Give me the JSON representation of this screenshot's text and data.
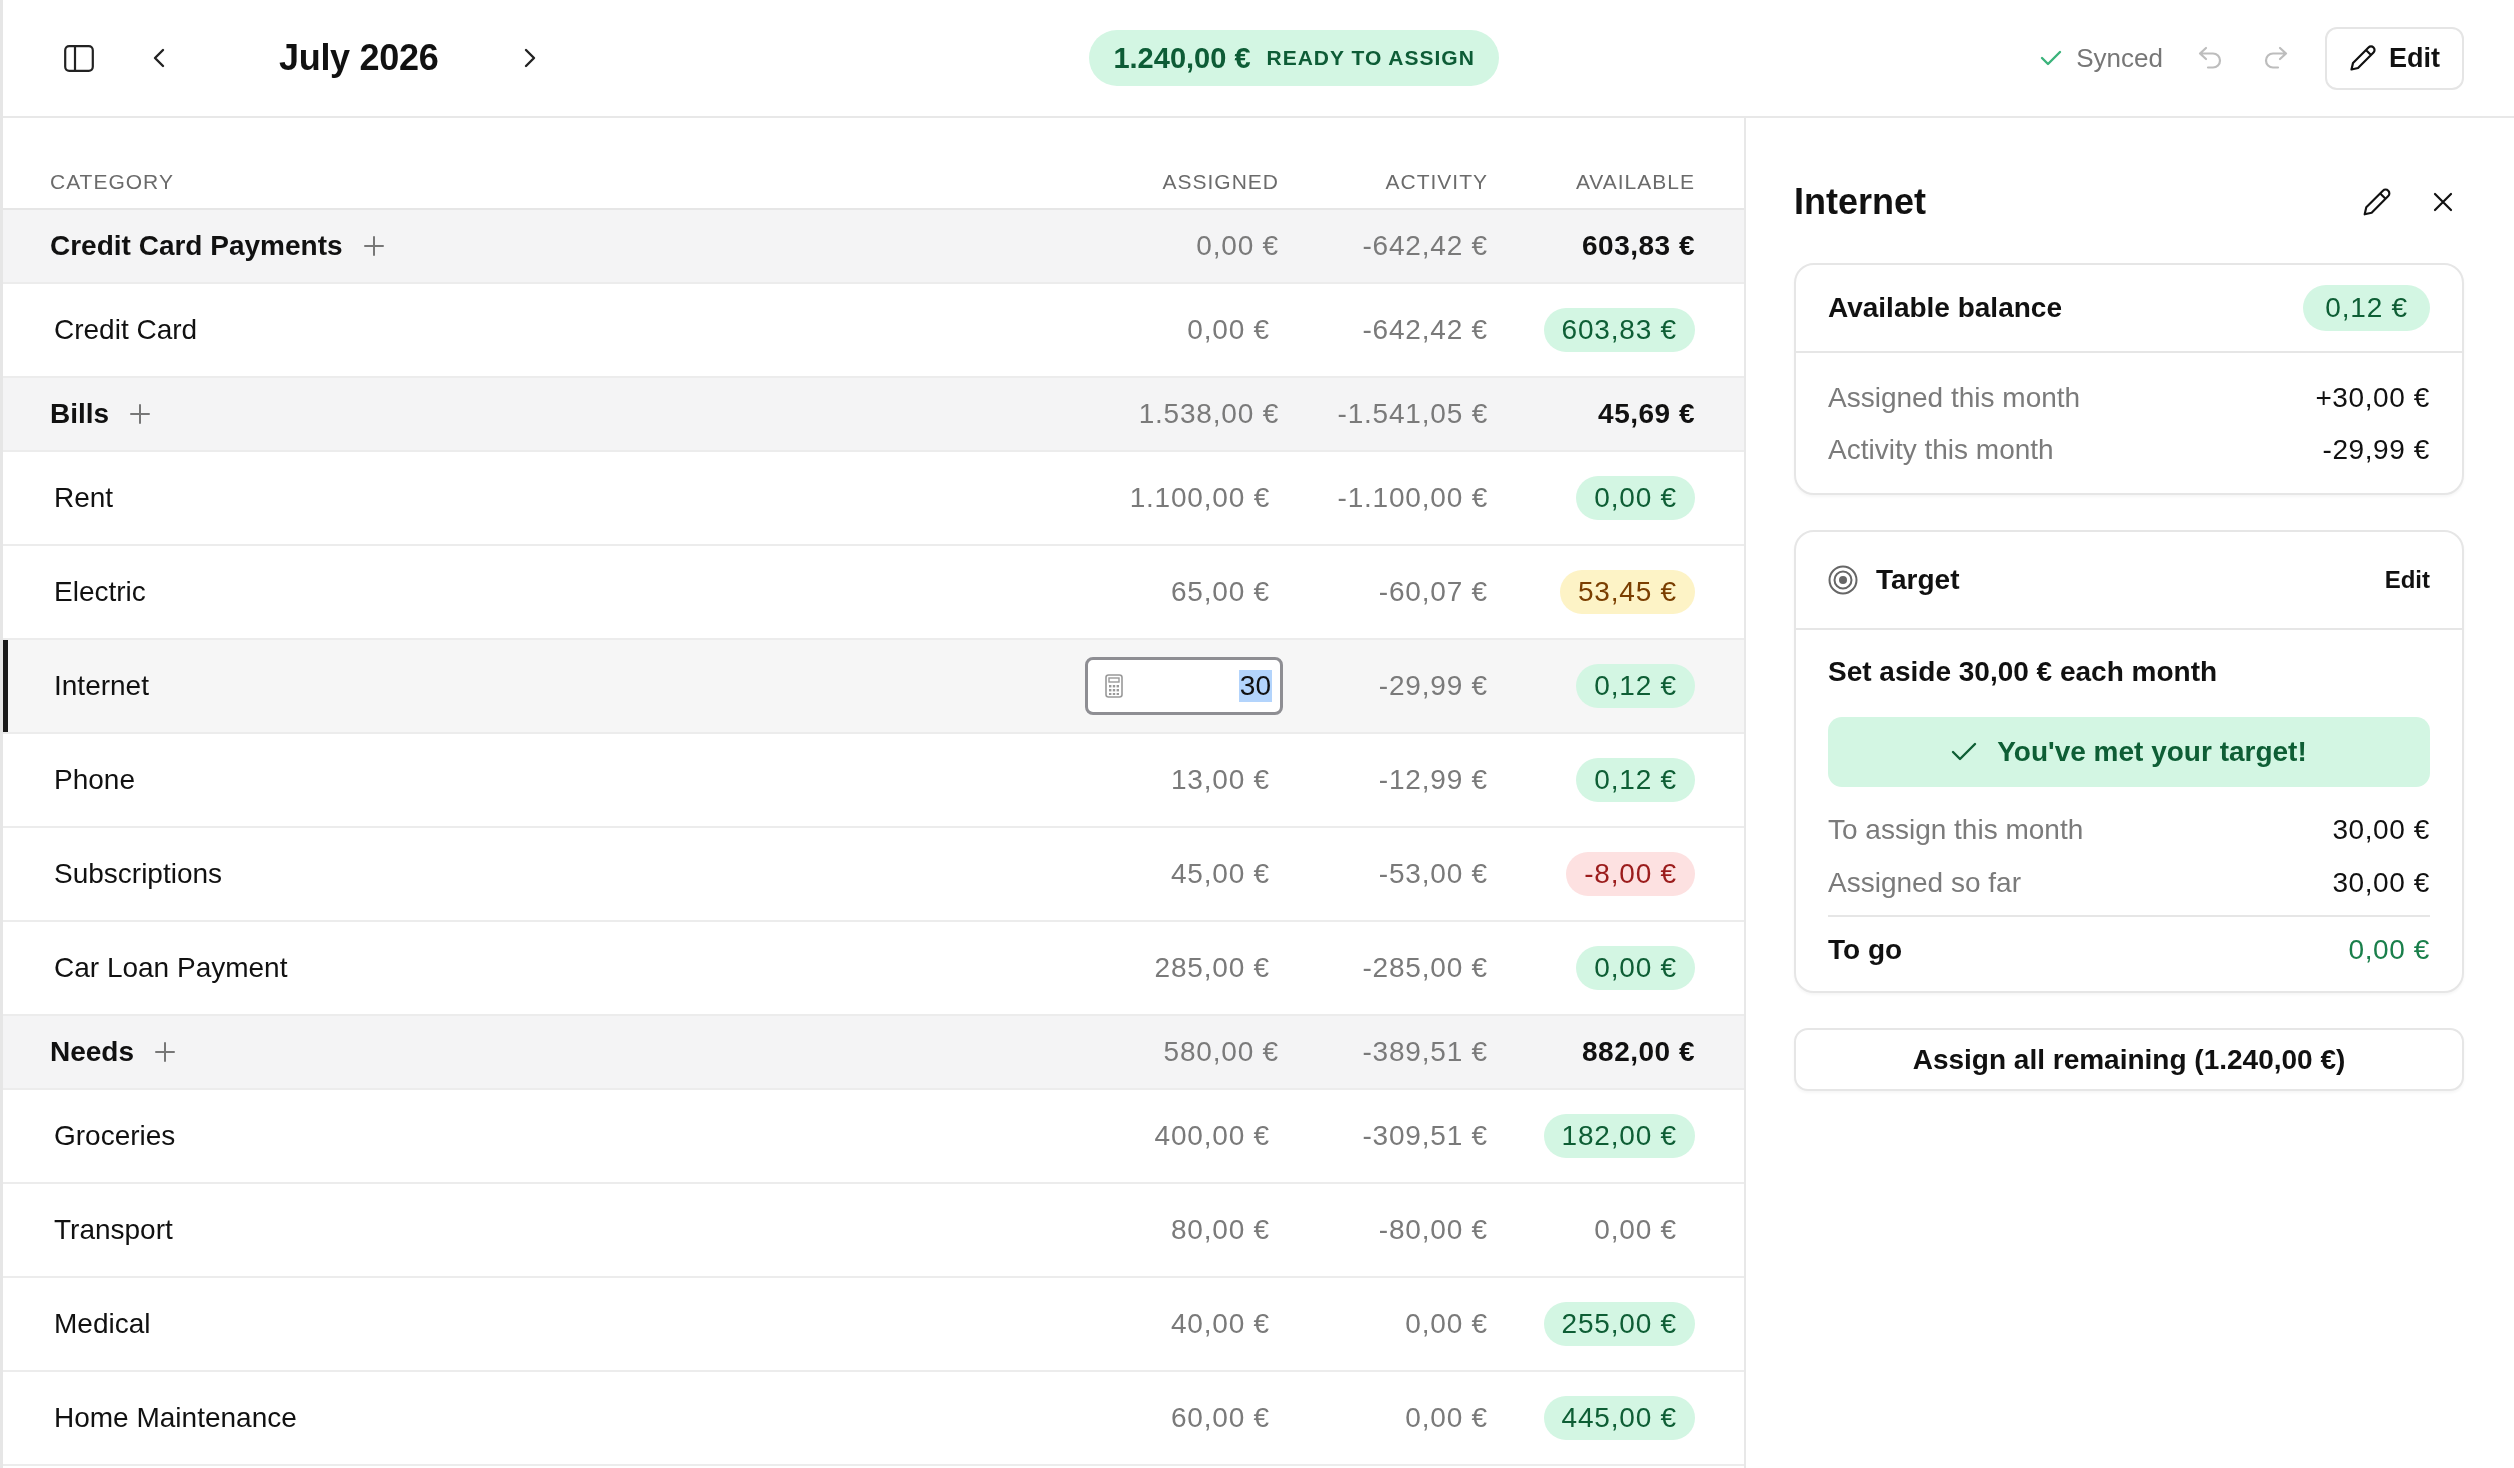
{
  "toolbar": {
    "month": "July 2026",
    "ready_to_assign": {
      "amount": "1.240,00 €",
      "label": "READY TO ASSIGN"
    },
    "sync_status": "Synced",
    "undo": {
      "disabled": true
    },
    "redo": {
      "disabled": true
    },
    "edit_button": "Edit"
  },
  "table": {
    "columns": [
      "CATEGORY",
      "ASSIGNED",
      "ACTIVITY",
      "AVAILABLE"
    ],
    "groups": [
      {
        "name": "Credit Card Payments",
        "assigned": "0,00 €",
        "activity": "-642,42 €",
        "available": "603,83 €",
        "categories": [
          {
            "name": "Credit Card",
            "assigned": "0,00 €",
            "activity": "-642,42 €",
            "available": "603,83 €",
            "kind": "funded",
            "selected": false,
            "editing": false
          }
        ]
      },
      {
        "name": "Bills",
        "assigned": "1.538,00 €",
        "activity": "-1.541,05 €",
        "available": "45,69 €",
        "categories": [
          {
            "name": "Rent",
            "assigned": "1.100,00 €",
            "activity": "-1.100,00 €",
            "available": "0,00 €",
            "kind": "funded",
            "selected": false,
            "editing": false
          },
          {
            "name": "Electric",
            "assigned": "65,00 €",
            "activity": "-60,07 €",
            "available": "53,45 €",
            "kind": "underfunded",
            "selected": false,
            "editing": false
          },
          {
            "name": "Internet",
            "assigned": "30",
            "activity": "-29,99 €",
            "available": "0,12 €",
            "kind": "funded",
            "selected": true,
            "editing": true
          },
          {
            "name": "Phone",
            "assigned": "13,00 €",
            "activity": "-12,99 €",
            "available": "0,12 €",
            "kind": "funded",
            "selected": false,
            "editing": false
          },
          {
            "name": "Subscriptions",
            "assigned": "45,00 €",
            "activity": "-53,00 €",
            "available": "-8,00 €",
            "kind": "overspent",
            "selected": false,
            "editing": false
          },
          {
            "name": "Car Loan Payment",
            "assigned": "285,00 €",
            "activity": "-285,00 €",
            "available": "0,00 €",
            "kind": "funded",
            "selected": false,
            "editing": false
          }
        ]
      },
      {
        "name": "Needs",
        "assigned": "580,00 €",
        "activity": "-389,51 €",
        "available": "882,00 €",
        "categories": [
          {
            "name": "Groceries",
            "assigned": "400,00 €",
            "activity": "-309,51 €",
            "available": "182,00 €",
            "kind": "funded",
            "selected": false,
            "editing": false
          },
          {
            "name": "Transport",
            "assigned": "80,00 €",
            "activity": "-80,00 €",
            "available": "0,00 €",
            "kind": "empty",
            "selected": false,
            "editing": false
          },
          {
            "name": "Medical",
            "assigned": "40,00 €",
            "activity": "0,00 €",
            "available": "255,00 €",
            "kind": "funded",
            "selected": false,
            "editing": false
          },
          {
            "name": "Home Maintenance",
            "assigned": "60,00 €",
            "activity": "0,00 €",
            "available": "445,00 €",
            "kind": "funded",
            "selected": false,
            "editing": false
          }
        ]
      }
    ]
  },
  "detail_panel": {
    "title": "Internet",
    "balance_card": {
      "title": "Available balance",
      "balance": {
        "amount": "0,12 €",
        "kind": "funded"
      },
      "rows": [
        {
          "label": "Assigned this month",
          "value": "+30,00 €"
        },
        {
          "label": "Activity this month",
          "value": "-29,99 €"
        }
      ]
    },
    "target_card": {
      "title": "Target",
      "edit_label": "Edit",
      "summary": "Set aside 30,00 € each month",
      "banner": "You've met your target!",
      "rows": [
        {
          "label": "To assign this month",
          "value": "30,00 €"
        },
        {
          "label": "Assigned so far",
          "value": "30,00 €"
        }
      ],
      "total": {
        "label": "To go",
        "value": "0,00 €"
      }
    },
    "assign_button": "Assign all remaining (1.240,00 €)"
  }
}
